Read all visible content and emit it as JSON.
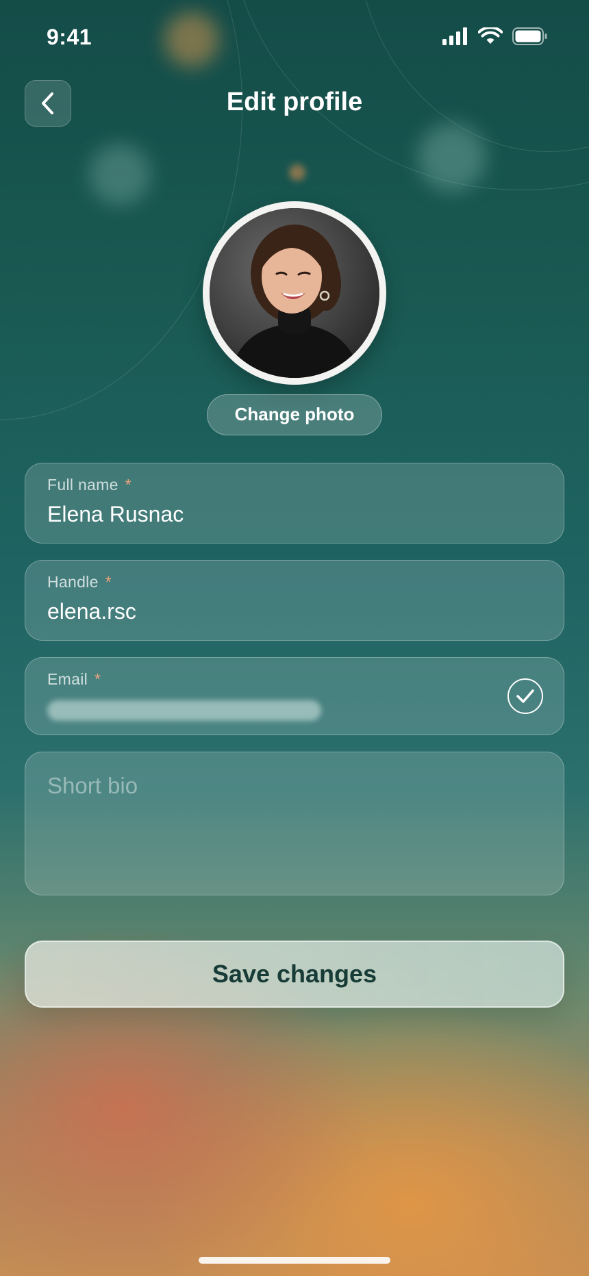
{
  "status_bar": {
    "time": "9:41",
    "icons": [
      "cellular-signal-icon",
      "wifi-icon",
      "battery-icon"
    ]
  },
  "header": {
    "back_icon": "chevron-left-icon",
    "title": "Edit profile"
  },
  "profile": {
    "change_photo_label": "Change photo"
  },
  "form": {
    "full_name": {
      "label": "Full name",
      "required_mark": "*",
      "value": "Elena Rusnac"
    },
    "handle": {
      "label": "Handle",
      "required_mark": "*",
      "value": "elena.rsc"
    },
    "email": {
      "label": "Email",
      "required_mark": "*",
      "status_icon": "checkmark-circle-icon"
    },
    "bio": {
      "placeholder": "Short bio",
      "value": ""
    }
  },
  "actions": {
    "save_label": "Save changes"
  },
  "colors": {
    "bg_top": "#144c48",
    "bg_mid": "#1f6462",
    "bg_bottom": "#c48d55",
    "required_accent": "#f0a37a",
    "save_text": "#173b36"
  }
}
